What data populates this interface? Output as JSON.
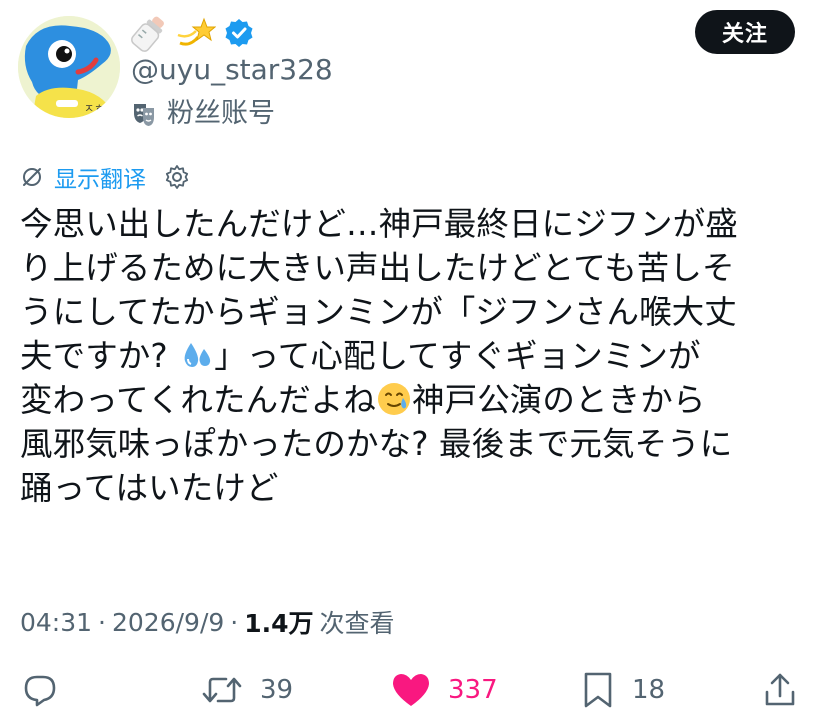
{
  "user": {
    "avatar_icon": "blue-creature-avatar",
    "name_emojis": [
      "baby-bottle-emoji",
      "shooting-star-emoji"
    ],
    "verified_icon": "verified-badge-icon",
    "handle": "@uyu_star328",
    "account_type_icon": "theater-masks-icon",
    "account_type_label": "粉丝账号",
    "follow_label": "关注"
  },
  "translate": {
    "icon": "no-translate-icon",
    "label": "显示翻译",
    "settings_icon": "gear-icon"
  },
  "tweet": {
    "line1": "今思い出したんだけど…神戸最終日にジフンが盛",
    "line2": "り上げるために大きい声出したけどとても苦しそ",
    "line3": "うにしてたからギョンミンが「ジフンさん喉大丈",
    "line4a": "夫ですか? ",
    "line4b": "」って心配してすぐギョンミンが",
    "line5a": "変わってくれたんだよね",
    "line5b": "神戸公演のときから",
    "line6": "風邪気味っぽかったのかな? 最後まで元気そうに",
    "line7": "踊ってはいたけど",
    "emoji_a": "sweat-droplets-emoji",
    "emoji_b": "smiling-face-with-tear-emoji"
  },
  "meta": {
    "time": "04:31",
    "separator": "·",
    "date": "2026/9/9",
    "views_count": "1.4万",
    "views_label": "次查看"
  },
  "actions": {
    "reply_icon": "reply-icon",
    "retweet_icon": "retweet-icon",
    "retweet_count": "39",
    "like_icon": "heart-icon",
    "like_count": "337",
    "bookmark_icon": "bookmark-icon",
    "bookmark_count": "18",
    "share_icon": "share-icon"
  },
  "colors": {
    "link_blue": "#1d9bf0",
    "like_pink": "#f91880",
    "secondary_text": "#536471",
    "primary_text": "#0f1419"
  }
}
